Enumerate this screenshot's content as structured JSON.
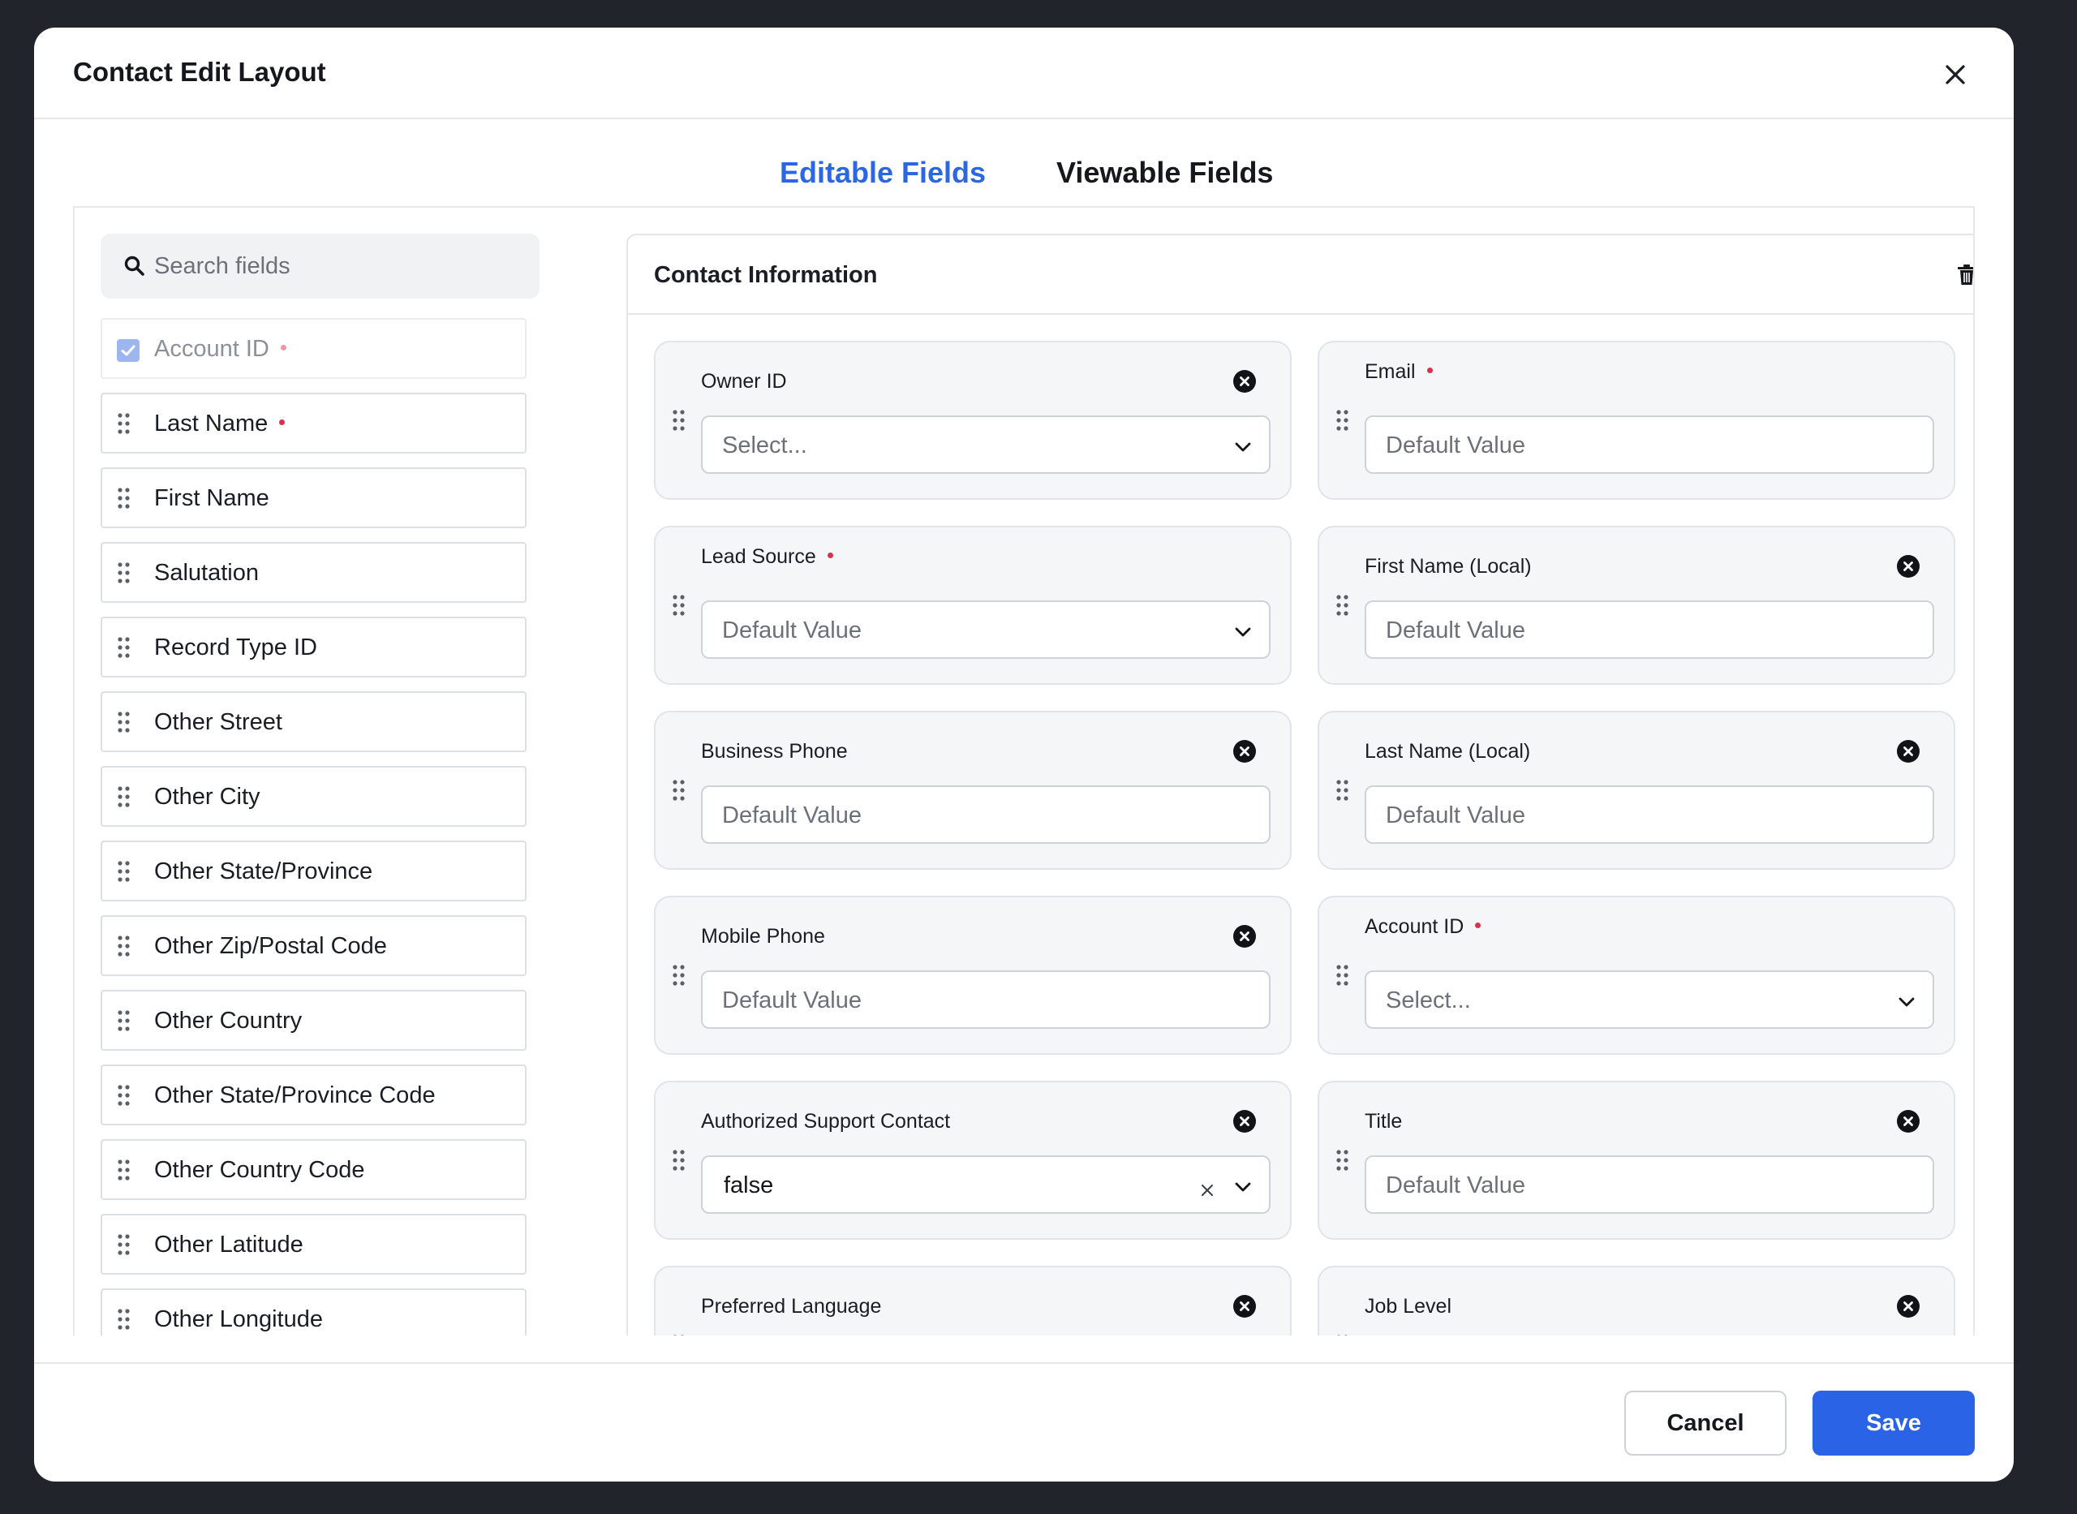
{
  "modal": {
    "title": "Contact Edit Layout"
  },
  "tabs": [
    {
      "label": "Editable Fields",
      "active": true
    },
    {
      "label": "Viewable Fields",
      "active": false
    }
  ],
  "search": {
    "placeholder": "Search fields",
    "value": ""
  },
  "field_list": [
    {
      "label": "Account ID",
      "required": true,
      "checked": true,
      "disabled": true
    },
    {
      "label": "Last Name",
      "required": true
    },
    {
      "label": "First Name"
    },
    {
      "label": "Salutation"
    },
    {
      "label": "Record Type ID"
    },
    {
      "label": "Other Street"
    },
    {
      "label": "Other City"
    },
    {
      "label": "Other State/Province"
    },
    {
      "label": "Other Zip/Postal Code"
    },
    {
      "label": "Other Country"
    },
    {
      "label": "Other State/Province Code"
    },
    {
      "label": "Other Country Code"
    },
    {
      "label": "Other Latitude"
    },
    {
      "label": "Other Longitude"
    }
  ],
  "section": {
    "title": "Contact Information",
    "cards": [
      {
        "label": "Owner ID",
        "type": "select",
        "value": "Select...",
        "removable": true
      },
      {
        "label": "Email",
        "type": "text",
        "placeholder": "Default Value",
        "required": true
      },
      {
        "label": "Lead Source",
        "type": "select",
        "value": "Default Value",
        "required": true
      },
      {
        "label": "First Name (Local)",
        "type": "text",
        "placeholder": "Default Value",
        "removable": true
      },
      {
        "label": "Business Phone",
        "type": "text",
        "placeholder": "Default Value",
        "removable": true
      },
      {
        "label": "Last Name (Local)",
        "type": "text",
        "placeholder": "Default Value",
        "removable": true
      },
      {
        "label": "Mobile Phone",
        "type": "text",
        "placeholder": "Default Value",
        "removable": true
      },
      {
        "label": "Account ID",
        "type": "select",
        "value": "Select...",
        "required": true
      },
      {
        "label": "Authorized Support Contact",
        "type": "select",
        "value": "false",
        "clearable": true,
        "removable": true
      },
      {
        "label": "Title",
        "type": "text",
        "placeholder": "Default Value",
        "removable": true
      },
      {
        "label": "Preferred Language",
        "type": "select",
        "removable": true
      },
      {
        "label": "Job Level",
        "type": "select",
        "removable": true
      }
    ]
  },
  "footer": {
    "cancel_label": "Cancel",
    "save_label": "Save"
  },
  "colors": {
    "accent": "#2a63e6",
    "tab_active": "#2c67e0",
    "required_dot": "#d6334b",
    "backdrop": "#22242b"
  }
}
